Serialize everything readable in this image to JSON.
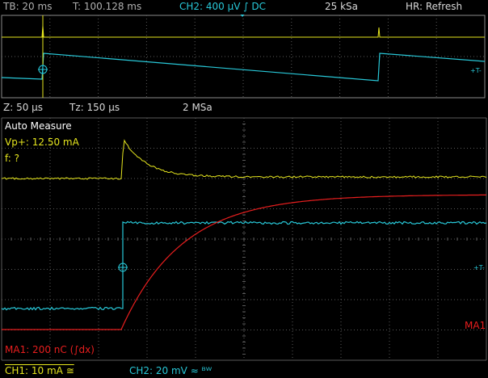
{
  "top_bar": {
    "timebase": "TB: 20 ms",
    "trigger_time": "T: 100.128 ms",
    "ch2_trigger": "CH2: 400 µV ∫ DC",
    "sample_rate": "25 kSa",
    "acq_mode": "HR: Refresh"
  },
  "zoom_bar": {
    "zoom_scale": "Z: 50 µs",
    "zoom_delay": "Tz: 150 µs",
    "zoom_rate": "2 MSa"
  },
  "measure": {
    "title": "Auto Measure",
    "vp": "Vp+: 12.50 mA",
    "freq": "f: ?"
  },
  "math": {
    "label": "MA1: 200 nC (∫dx)",
    "marker": "MA1"
  },
  "bottom_bar": {
    "ch1": "CH1: 10 mA ≅",
    "ch2": "CH2: 20 mV ≈ ᴮᵂ"
  },
  "colors": {
    "ch1": "#e6e61e",
    "ch2": "#28c8d8",
    "math": "#e81e1e",
    "grid": "#5a5a5a",
    "text": "#d8d8d8"
  }
}
